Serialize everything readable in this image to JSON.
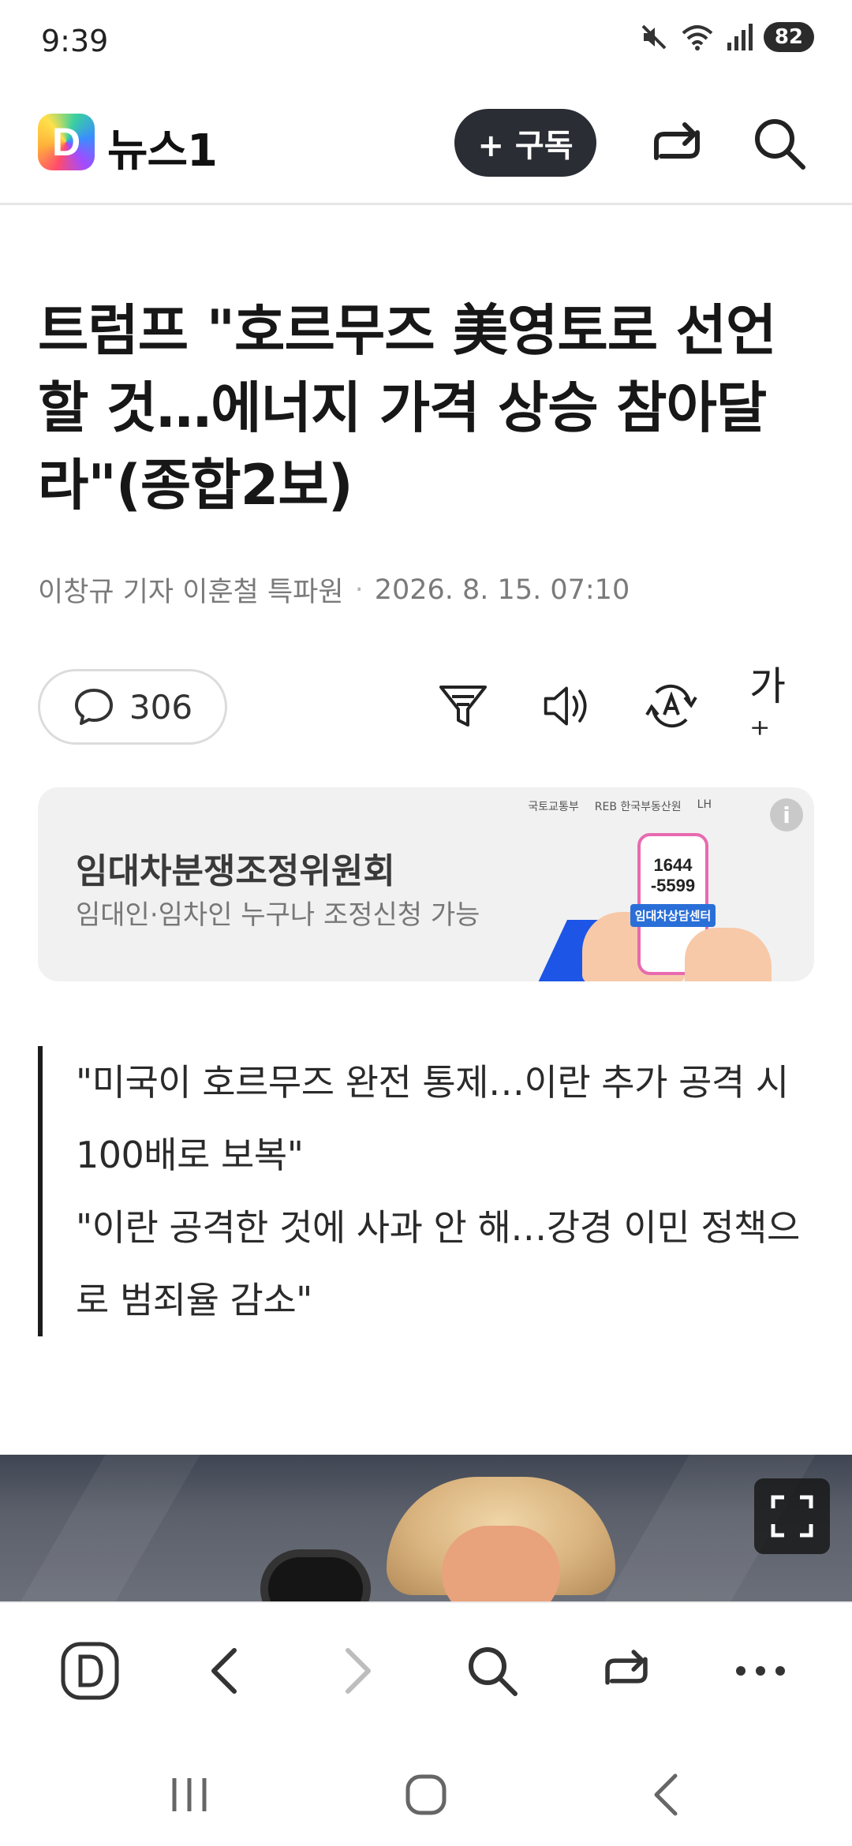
{
  "status_bar": {
    "time": "9:39",
    "battery": "82",
    "icons": [
      "mute-icon",
      "wifi-icon",
      "signal-icon",
      "battery-icon"
    ]
  },
  "header": {
    "logo_letter": "D",
    "brand": "뉴스1",
    "subscribe_label": "+ 구독",
    "icons": [
      "share-icon",
      "search-icon"
    ]
  },
  "article": {
    "headline": "트럼프 \"호르무즈 美영토로 선언할 것…에너지 가격 상승 참아달라\"(종합2보)",
    "authors": "이창규 기자 이훈철 특파원",
    "byline_separator": "·",
    "datetime": "2026. 8. 15. 07:10",
    "comment_count": "306",
    "tools": [
      "filter-icon",
      "speaker-icon",
      "translate-icon",
      "font-size-icon"
    ],
    "font_tool_label": "가⁺",
    "summary": [
      "\"미국이 호르무즈 완전 통제…이란 추가 공격 시 100배로 보복\"",
      "\"이란 공격한 것에 사과 안 해…강경 이민 정책으로 범죄율 감소\""
    ]
  },
  "ad": {
    "title": "임대차분쟁조정위원회",
    "subtitle": "임대인·임차인 누구나 조정신청 가능",
    "phone_number_line1": "1644",
    "phone_number_line2": "-5599",
    "center_label": "임대차상담센터",
    "sponsor_logos": [
      "국토교통부",
      "REB 한국부동산원",
      "LH"
    ],
    "info_label": "i"
  },
  "browser_bar": {
    "buttons": [
      "home-icon",
      "back-icon",
      "forward-icon",
      "search-icon",
      "share-icon",
      "more-icon"
    ]
  },
  "nav_bar": {
    "buttons": [
      "recent-apps-icon",
      "home-icon",
      "back-icon"
    ]
  },
  "colors": {
    "subscribe_bg": "#2a2d33",
    "ad_bg": "#f1f1f1",
    "quote_bar": "#1c1c1c"
  }
}
